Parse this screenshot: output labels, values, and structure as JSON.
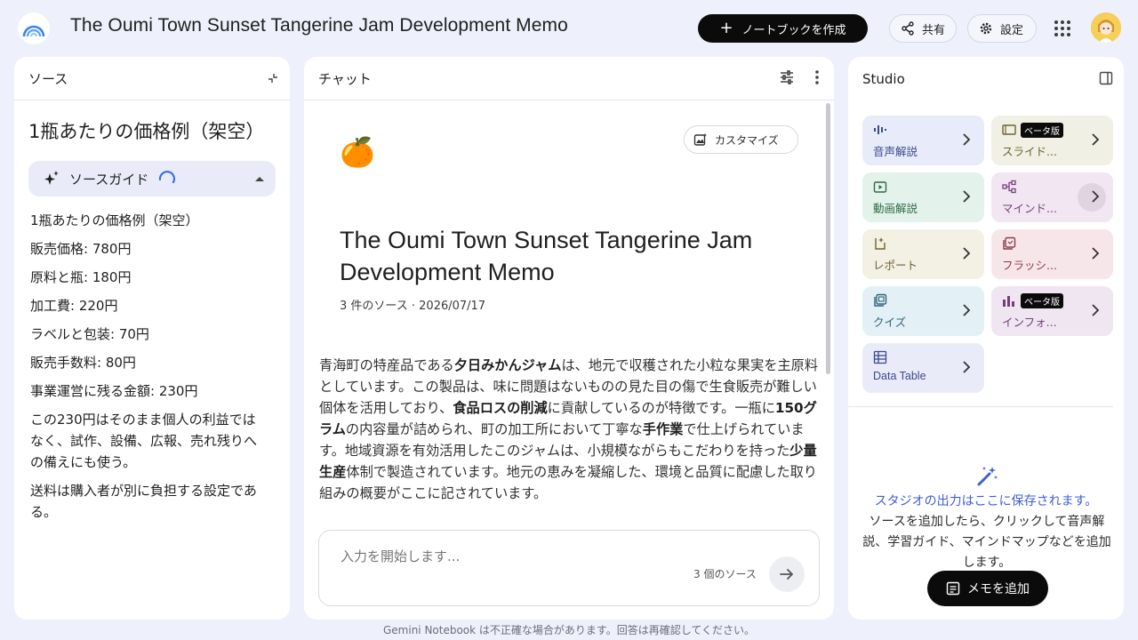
{
  "header": {
    "title": "The Oumi Town Sunset Tangerine Jam Development Memo",
    "create_label": "ノートブックを作成",
    "share_label": "共有",
    "settings_label": "設定"
  },
  "sources": {
    "panel_title": "ソース",
    "heading": "1瓶あたりの価格例（架空）",
    "guide_label": "ソースガイド",
    "lines": [
      "1瓶あたりの価格例（架空）",
      "販売価格: 780円",
      "原料と瓶: 180円",
      "加工費: 220円",
      "ラベルと包装: 70円",
      "販売手数料: 80円",
      "事業運営に残る金額: 230円",
      "この230円はそのまま個人の利益ではなく、試作、設備、広報、売れ残りへの備えにも使う。",
      "送料は購入者が別に負担する設定である。"
    ]
  },
  "chat": {
    "panel_title": "チャット",
    "customize_label": "カスタマイズ",
    "emoji": "🍊",
    "notebook_title": "The Oumi Town Sunset Tangerine Jam Development Memo",
    "meta": "3 件のソース · 2026/07/17",
    "summary": {
      "p1": "青海町の特産品である",
      "b1": "夕日みかんジャム",
      "p2": "は、地元で収穫された小粒な果実を主原料としています。この製品は、味に問題はないものの見た目の傷で生食販売が難しい個体を活用しており、",
      "b2": "食品ロスの削減",
      "p3": "に貢献しているのが特徴です。一瓶に",
      "b3": "150グラム",
      "p4": "の内容量が詰められ、町の加工所において丁寧な",
      "b4": "手作業",
      "p5": "で仕上げられています。地域資源を有効活用したこのジャムは、小規模ながらもこだわりを持った",
      "b5": "少量生産",
      "p6": "体制で製造されています。地元の恵みを凝縮した、環境と品質に配慮した取り組みの概要がここに記されています。"
    },
    "input_placeholder": "入力を開始します...",
    "source_count": "3 個のソース"
  },
  "studio": {
    "panel_title": "Studio",
    "beta_label": "ベータ版",
    "tiles": [
      {
        "label": "音声解説",
        "bg": "#e7ebfa",
        "color": "#3a4a8c"
      },
      {
        "label": "スライド...",
        "bg": "#f1f0e4",
        "color": "#6b6530",
        "beta": true
      },
      {
        "label": "動画解説",
        "bg": "#e3f2ea",
        "color": "#2e6b46"
      },
      {
        "label": "マインド...",
        "bg": "#f1e6f2",
        "color": "#7a3f7f"
      },
      {
        "label": "レポート",
        "bg": "#f3f0e4",
        "color": "#6e6330"
      },
      {
        "label": "フラッシ...",
        "bg": "#f7e6e9",
        "color": "#8a3b4b"
      },
      {
        "label": "クイズ",
        "bg": "#e3f1f6",
        "color": "#2d6479"
      },
      {
        "label": "インフォ...",
        "bg": "#f0e6f1",
        "color": "#743f78",
        "beta": true
      },
      {
        "label": "Data Table",
        "bg": "#e9ebf9",
        "color": "#3a4a8c"
      }
    ],
    "note_title": "スタジオの出力はここに保存されます。",
    "note_body": "ソースを追加したら、クリックして音声解説、学習ガイド、マインドマップなどを追加します。",
    "memo_label": "メモを追加"
  },
  "footer": "Gemini Notebook は不正確な場合があります。回答は再確認してください。"
}
